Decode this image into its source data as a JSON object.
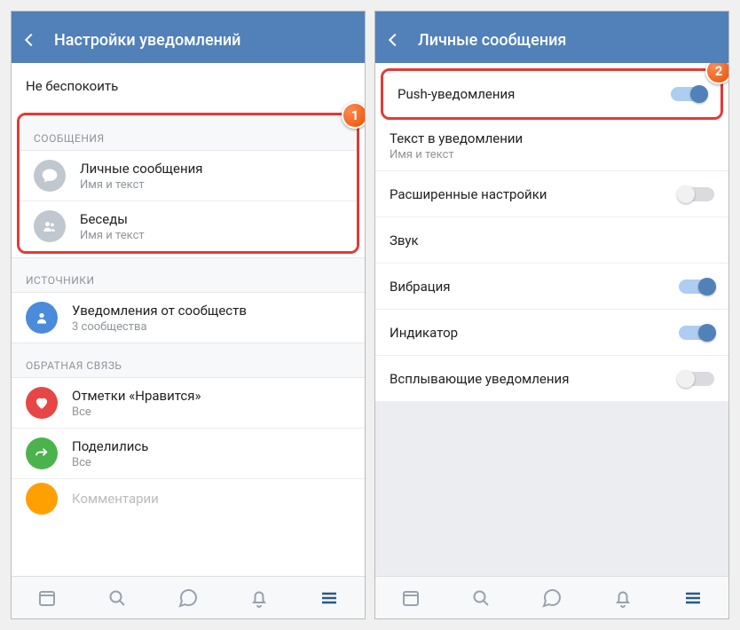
{
  "left": {
    "title": "Настройки уведомлений",
    "dnd": "Не беспокоить",
    "sec_messages": "СООБЩЕНИЯ",
    "pm_title": "Личные сообщения",
    "pm_sub": "Имя и текст",
    "chats_title": "Беседы",
    "chats_sub": "Имя и текст",
    "sec_sources": "ИСТОЧНИКИ",
    "communities_title": "Уведомления от сообществ",
    "communities_sub": "3 сообщества",
    "sec_feedback": "ОБРАТНАЯ СВЯЗЬ",
    "likes_title": "Отметки «Нравится»",
    "likes_sub": "Все",
    "reposts_title": "Поделились",
    "reposts_sub": "Все",
    "comments_title": "Комментарии",
    "badge": "1"
  },
  "right": {
    "title": "Личные сообщения",
    "push": "Push-уведомления",
    "text_in_notif_title": "Текст в уведомлении",
    "text_in_notif_sub": "Имя и текст",
    "advanced": "Расширенные настройки",
    "sound": "Звук",
    "vibration": "Вибрация",
    "indicator": "Индикатор",
    "popup": "Всплывающие уведомления",
    "badge": "2"
  }
}
